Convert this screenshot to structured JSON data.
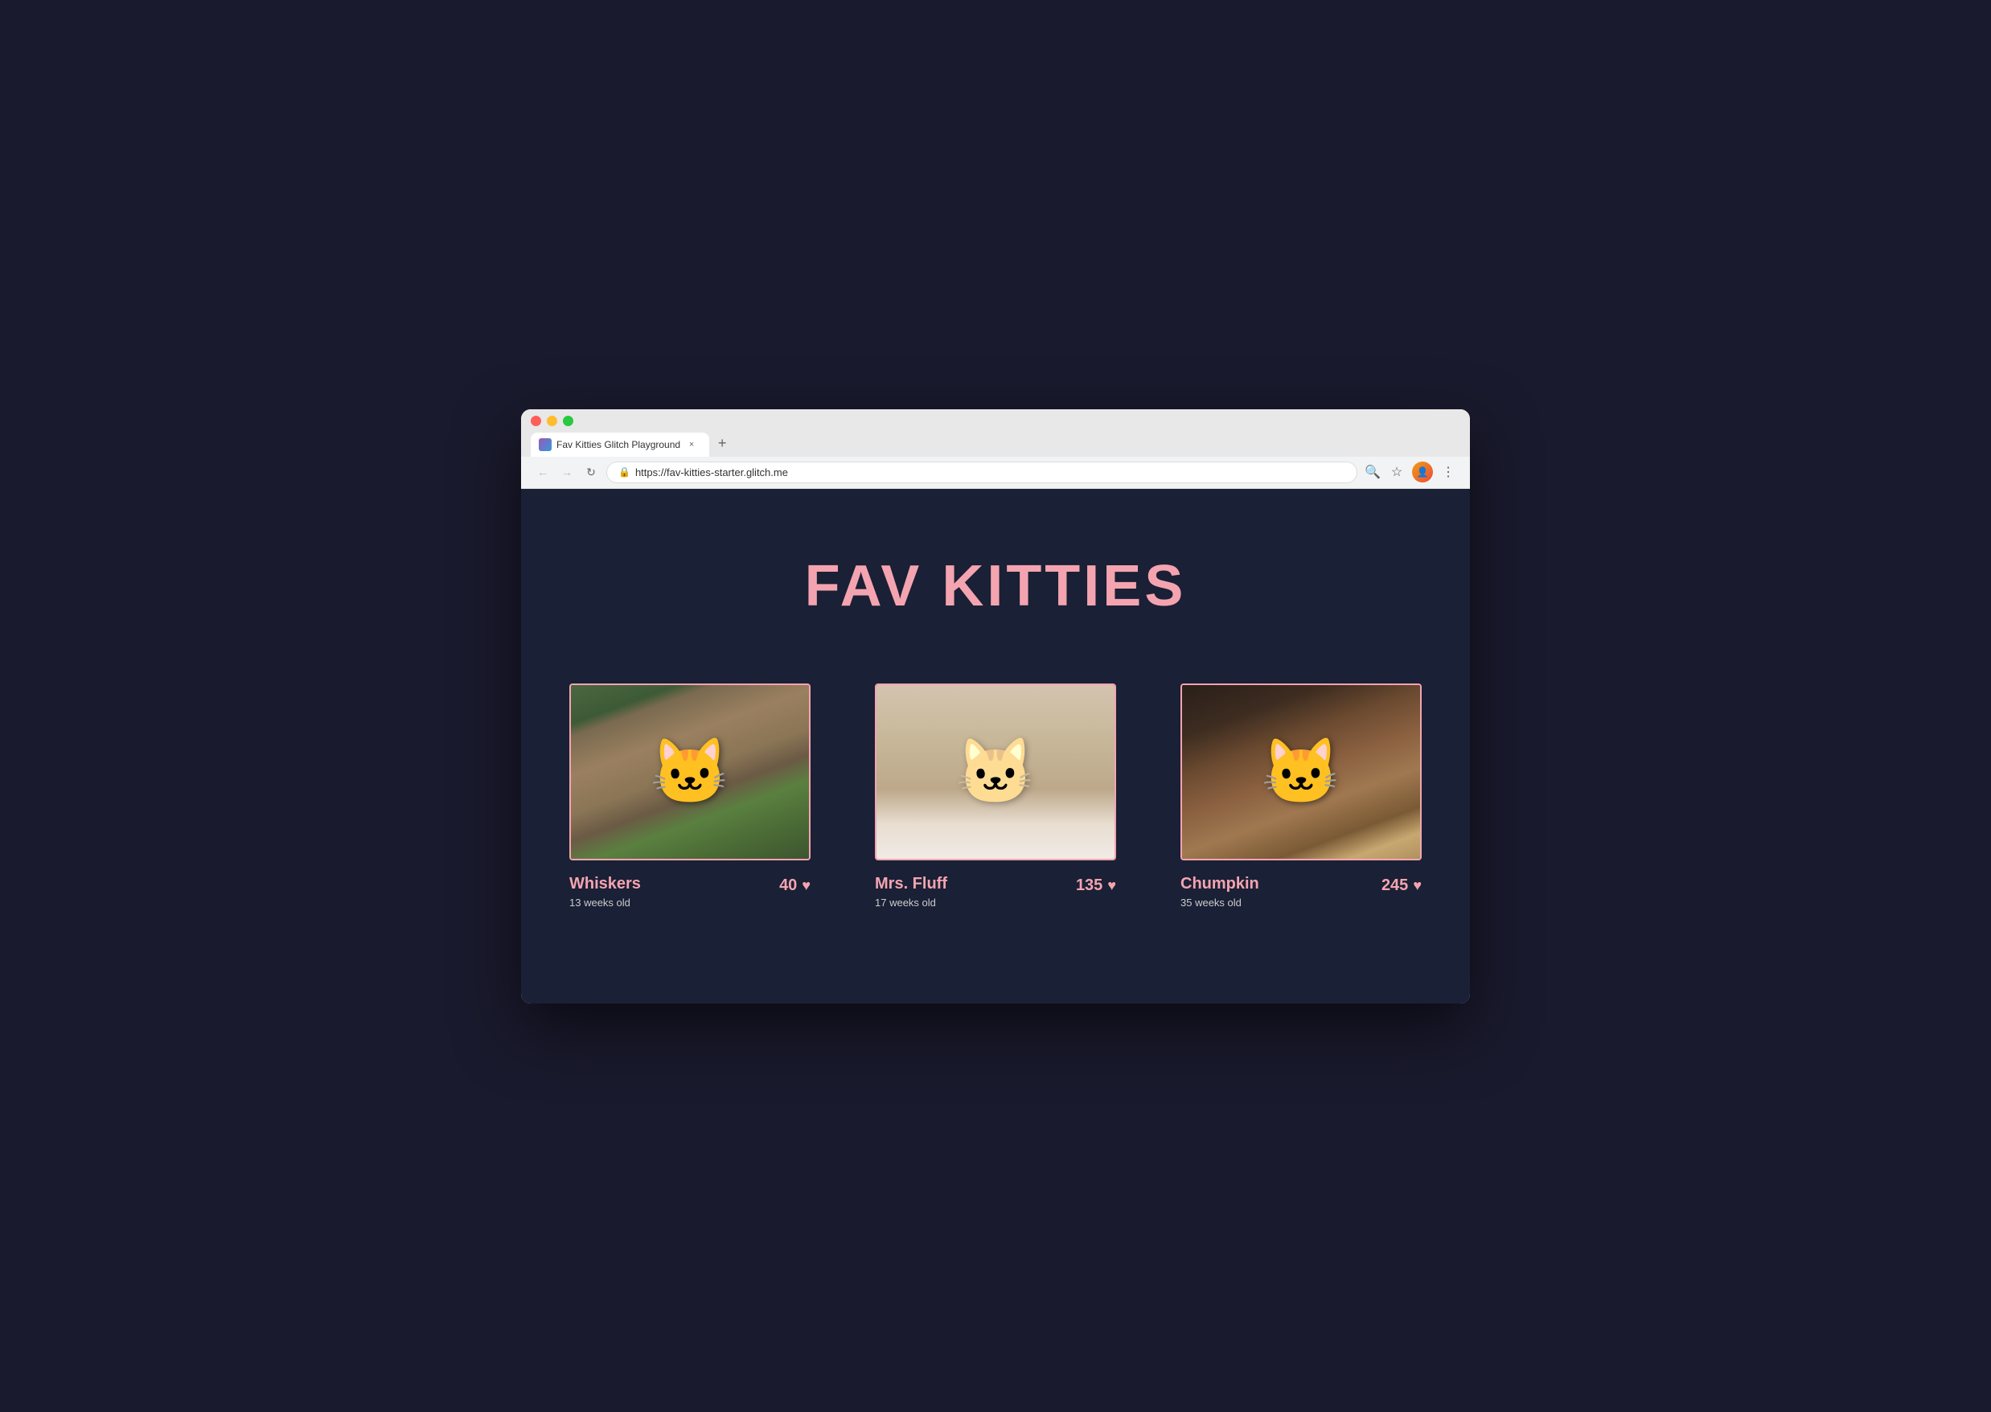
{
  "browser": {
    "tab_title": "Fav Kitties Glitch Playground",
    "tab_close_label": "×",
    "tab_new_label": "+",
    "url": "https://fav-kitties-starter.glitch.me",
    "nav": {
      "back_label": "←",
      "forward_label": "→",
      "reload_label": "↻"
    },
    "toolbar": {
      "search_label": "🔍",
      "star_label": "☆",
      "menu_label": "⋮"
    }
  },
  "page": {
    "title": "FAV KITTIES",
    "accent_color": "#f4a4b0",
    "bg_color": "#1a2035",
    "kitties": [
      {
        "id": "whiskers",
        "name": "Whiskers",
        "age": "13 weeks old",
        "votes": "40",
        "cat_type": "whiskers"
      },
      {
        "id": "mrs-fluff",
        "name": "Mrs. Fluff",
        "age": "17 weeks old",
        "votes": "135",
        "cat_type": "fluff"
      },
      {
        "id": "chumpkin",
        "name": "Chumpkin",
        "age": "35 weeks old",
        "votes": "245",
        "cat_type": "chumpkin"
      }
    ]
  }
}
